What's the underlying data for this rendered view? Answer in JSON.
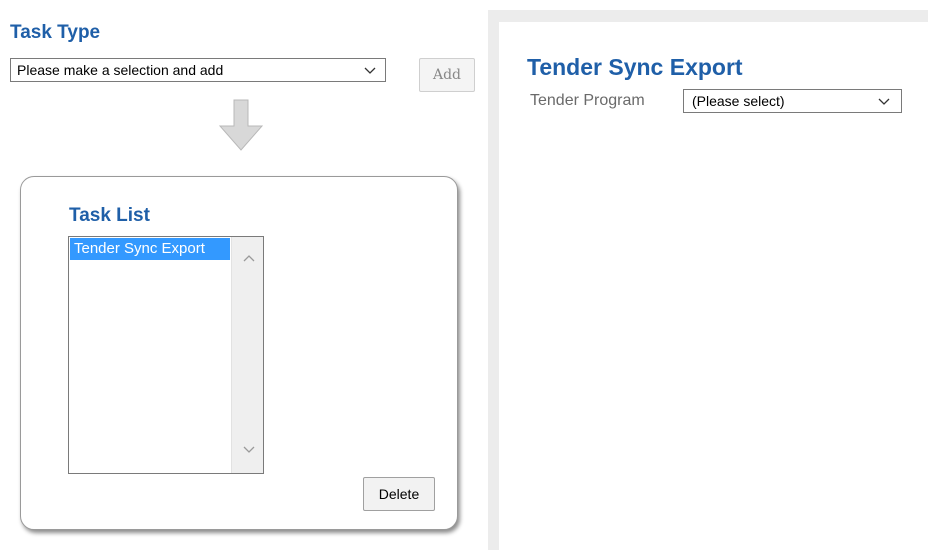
{
  "task_type": {
    "title": "Task Type",
    "select_value": "Please make a selection and add",
    "add_label": "Add"
  },
  "task_list": {
    "title": "Task List",
    "items": [
      "Tender Sync Export"
    ],
    "selected_index": 0,
    "delete_label": "Delete"
  },
  "export_panel": {
    "title": "Tender Sync Export",
    "tender_program_label": "Tender Program",
    "tender_program_value": "(Please select)"
  },
  "colors": {
    "heading": "#1f5fa8",
    "selection": "#3399ff",
    "panel_frame": "#ececec"
  },
  "icons": {
    "dropdown": "chevron-down-icon",
    "flow": "down-arrow-icon",
    "scroll_up": "chevron-up-icon",
    "scroll_down": "chevron-down-icon"
  }
}
